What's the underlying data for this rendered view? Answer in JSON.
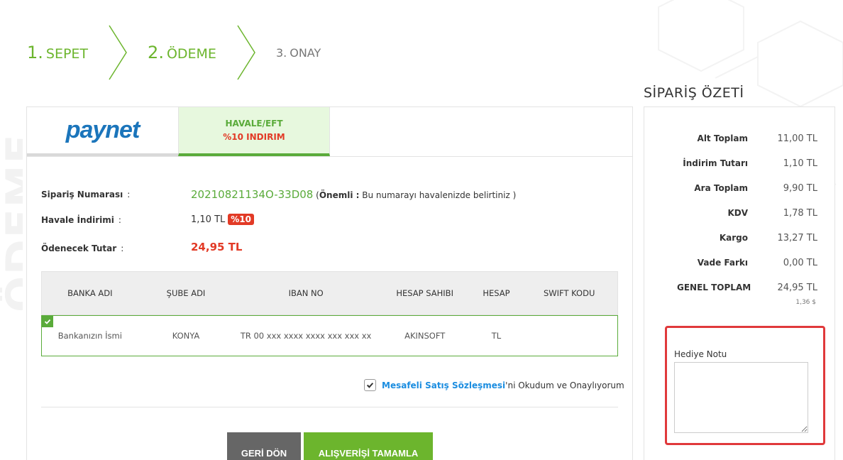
{
  "steps": [
    {
      "num": "1.",
      "label": "SEPET"
    },
    {
      "num": "2.",
      "label": "ÖDEME"
    },
    {
      "num": "3.",
      "label": "ONAY"
    }
  ],
  "watermark": "ÖDEME",
  "tabs": {
    "paynet": "paynet",
    "havale_title": "HAVALE/EFT",
    "havale_discount": "%10 INDIRIM"
  },
  "order": {
    "number_label": "Sipariş Numarası",
    "number_value": "20210821134O-33D08",
    "note_bold": "Önemli :",
    "note_text": " Bu numarayı havalenizde belirtiniz )",
    "note_open": " (",
    "discount_label": "Havale İndirimi",
    "discount_value": "1,10 TL",
    "discount_badge": "%10",
    "total_label": "Ödenecek Tutar",
    "total_value": "24,95 TL",
    "colon": ":"
  },
  "bank": {
    "headers": [
      "BANKA ADI",
      "ŞUBE ADI",
      "IBAN NO",
      "HESAP SAHIBI",
      "HESAP",
      "SWIFT KODU"
    ],
    "row": [
      "Bankanızın İsmi",
      "KONYA",
      "TR 00 xxx xxxx xxxx xxx xxx xx",
      "AKINSOFT",
      "TL",
      ""
    ]
  },
  "agreement": {
    "link": "Mesafeli Satış Sözleşmesi",
    "text": "'ni Okudum ve Onaylıyorum",
    "checked": true
  },
  "buttons": {
    "back": "GERİ DÖN",
    "complete": "ALIŞVERİŞİ TAMAMLA"
  },
  "summary": {
    "title": "SİPARİŞ ÖZETİ",
    "rows": [
      {
        "k": "Alt Toplam",
        "v": "11,00 TL"
      },
      {
        "k": "İndirim Tutarı",
        "v": "1,10 TL"
      },
      {
        "k": "Ara Toplam",
        "v": "9,90 TL"
      },
      {
        "k": "KDV",
        "v": "1,78 TL"
      },
      {
        "k": "Kargo",
        "v": "13,27 TL"
      },
      {
        "k": "Vade Farkı",
        "v": "0,00 TL"
      },
      {
        "k": "GENEL TOPLAM",
        "v": "24,95 TL"
      }
    ],
    "usd": "1,36 $",
    "gift_label": "Hediye Notu",
    "gift_value": ""
  },
  "colors": {
    "green": "#6cb52d",
    "red": "#e23a26",
    "blue": "#1b75bb",
    "highlight": "#e0393b"
  }
}
